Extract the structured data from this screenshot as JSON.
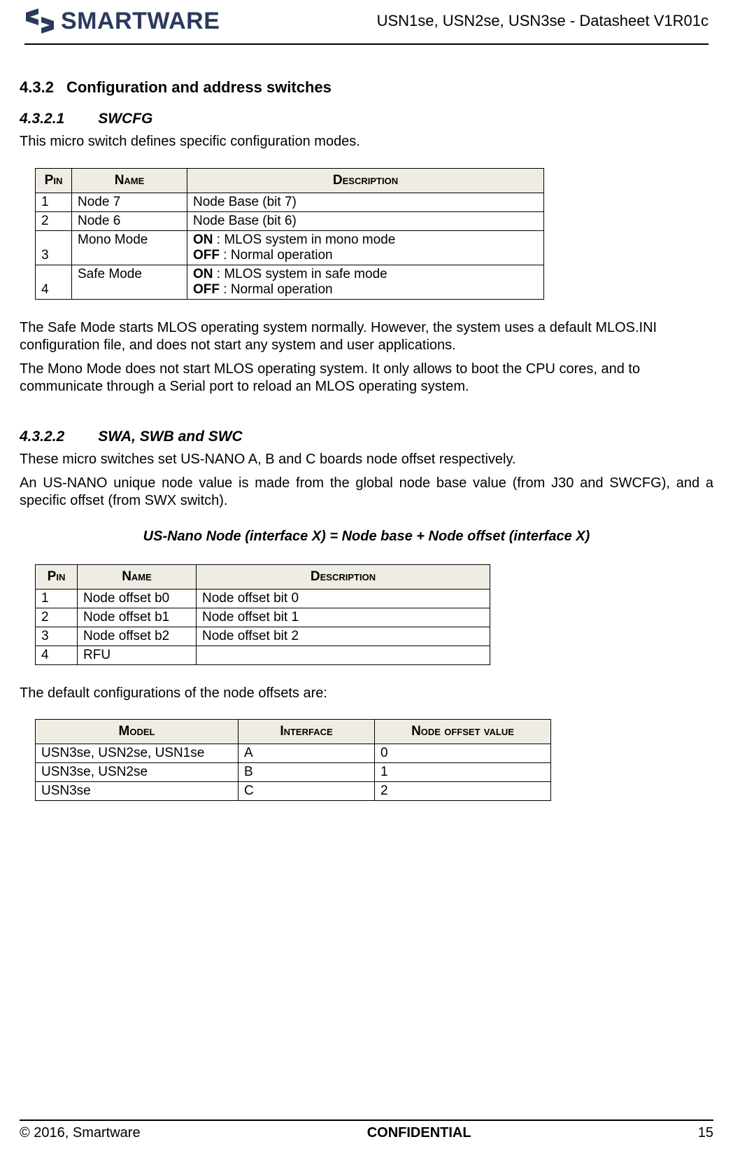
{
  "header": {
    "logo_text": "SMARTWARE",
    "doc_title": "USN1se, USN2se, USN3se - Datasheet V1R01c"
  },
  "s432": {
    "num": "4.3.2",
    "title": "Configuration and address switches"
  },
  "s4321": {
    "num": "4.3.2.1",
    "title": "SWCFG",
    "intro": "This micro switch defines specific configuration modes.",
    "table": {
      "headers": {
        "pin": "Pin",
        "name": "Name",
        "desc": "Description"
      },
      "rows": [
        {
          "pin": "1",
          "name": "Node 7",
          "desc": "Node Base (bit 7)"
        },
        {
          "pin": "2",
          "name": "Node 6",
          "desc": "Node Base (bit 6)"
        },
        {
          "pin": "3",
          "name": "Mono Mode",
          "on_label": "ON",
          "on_text": "  : MLOS system in mono mode",
          "off_label": "OFF",
          "off_text": " : Normal operation"
        },
        {
          "pin": "4",
          "name": "Safe Mode",
          "on_label": "ON",
          "on_text": "  : MLOS system in safe mode",
          "off_label": "OFF",
          "off_text": " : Normal operation"
        }
      ]
    },
    "p1": "The Safe Mode starts MLOS operating system normally. However, the system uses a default MLOS.INI configuration file, and does not start any system and user applications.",
    "p2": "The Mono Mode does not start MLOS operating system. It only allows to boot the CPU cores, and to communicate through a Serial port to reload an MLOS operating system."
  },
  "s4322": {
    "num": "4.3.2.2",
    "title": "SWA, SWB and SWC",
    "intro1": "These micro switches set US-NANO A, B and C boards node offset respectively.",
    "intro2": "An US-NANO unique node value is made from the global node base value (from J30 and SWCFG), and a specific offset (from SWX switch).",
    "formula": "US-Nano Node (interface X) = Node base + Node offset (interface X)",
    "table": {
      "headers": {
        "pin": "Pin",
        "name": "Name",
        "desc": "Description"
      },
      "rows": [
        {
          "pin": "1",
          "name": "Node offset b0",
          "desc": "Node offset bit 0"
        },
        {
          "pin": "2",
          "name": "Node offset b1",
          "desc": "Node offset bit 1"
        },
        {
          "pin": "3",
          "name": "Node offset b2",
          "desc": "Node offset bit 2"
        },
        {
          "pin": "4",
          "name": "RFU",
          "desc": ""
        }
      ]
    },
    "p_after": "The default configurations of the node offsets are:",
    "table2": {
      "headers": {
        "model": "Model",
        "interface": "Interface",
        "value": "Node offset value"
      },
      "rows": [
        {
          "model": "USN3se, USN2se, USN1se",
          "interface": "A",
          "value": "0"
        },
        {
          "model": "USN3se, USN2se",
          "interface": "B",
          "value": "1"
        },
        {
          "model": "USN3se",
          "interface": "C",
          "value": "2"
        }
      ]
    }
  },
  "footer": {
    "left": "© 2016, Smartware",
    "center": "CONFIDENTIAL",
    "right": "15"
  }
}
